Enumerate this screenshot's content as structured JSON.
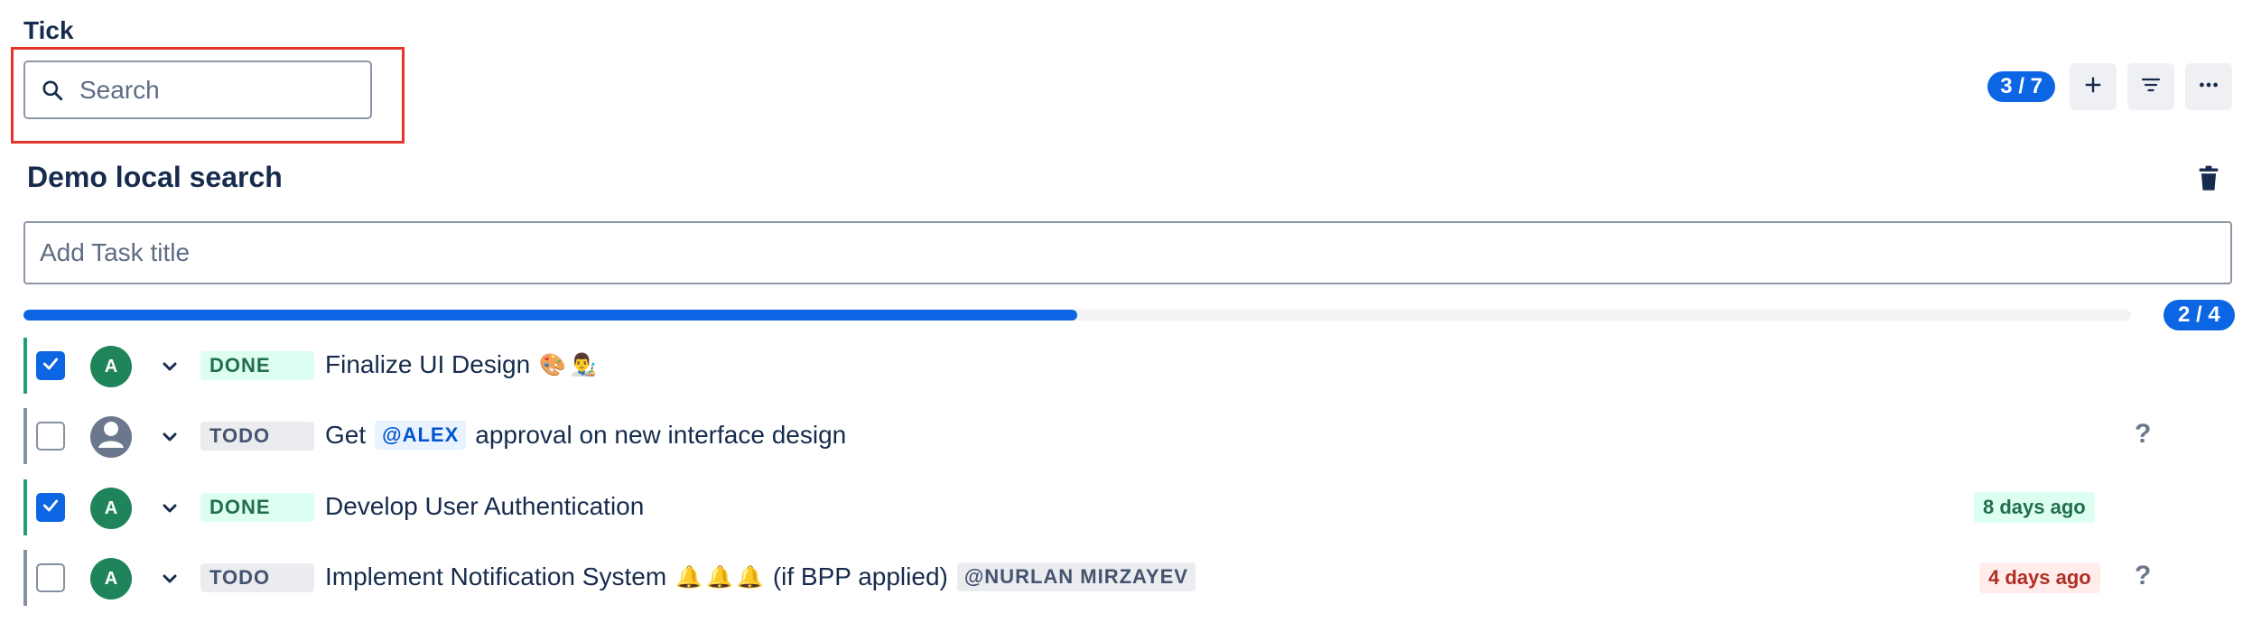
{
  "app": {
    "title": "Tick"
  },
  "search": {
    "placeholder": "Search",
    "icon": "search-icon"
  },
  "toolbar": {
    "count": "3 / 7",
    "add_icon": "plus-icon",
    "filter_icon": "filter-icon",
    "more_icon": "more-horizontal-icon"
  },
  "list": {
    "title": "Demo local search",
    "delete_icon": "trash-icon",
    "add_task_placeholder": "Add Task title",
    "progress": {
      "label": "2 / 4",
      "fraction": 0.5
    }
  },
  "tasks": [
    {
      "checked": true,
      "avatar": "A",
      "status": "DONE",
      "title": "Finalize UI Design",
      "emoji": [
        "🎨",
        "👨‍🎨"
      ]
    },
    {
      "checked": false,
      "avatar": "",
      "status": "TODO",
      "title_before": "Get",
      "mention": "@ALEX",
      "title_after": "approval on new interface design",
      "help": "?"
    },
    {
      "checked": true,
      "avatar": "A",
      "status": "DONE",
      "title": "Develop User Authentication",
      "date": "8 days ago"
    },
    {
      "checked": false,
      "avatar": "A",
      "status": "TODO",
      "title_before": "Implement Notification System",
      "emoji": [
        "🔔",
        "🔔",
        "🔔"
      ],
      "title_after": "(if BPP applied)",
      "mention": "@NURLAN MIRZAYEV",
      "date": "4 days ago",
      "help": "?"
    }
  ],
  "colors": {
    "accent": "#0c66e4",
    "done": "#22a06b",
    "overdue": "#ae2e24"
  }
}
